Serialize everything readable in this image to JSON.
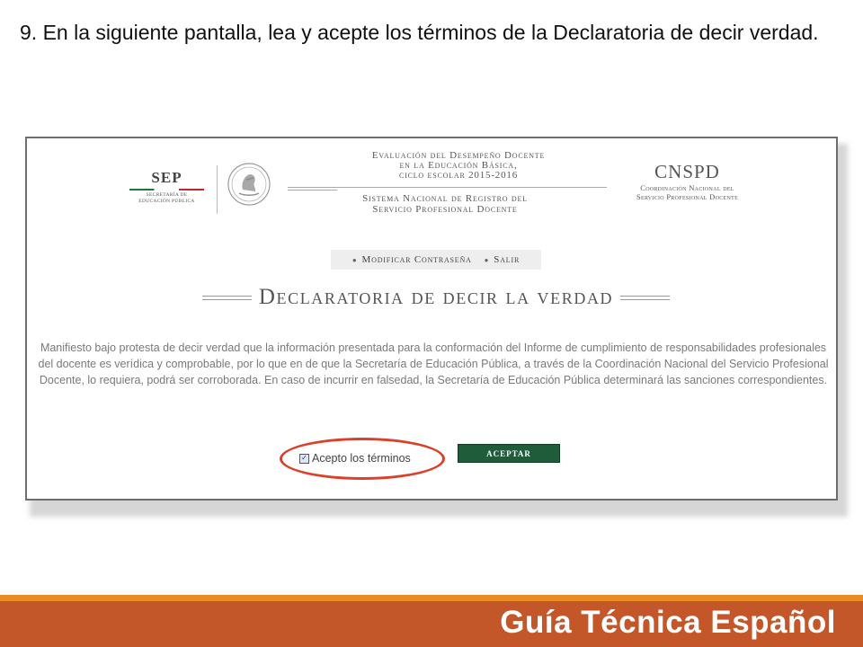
{
  "slide": {
    "heading": "9. En la siguiente pantalla, lea y acepte los términos de la Declaratoria de decir verdad."
  },
  "header": {
    "sep_logo_text": "SEP",
    "sep_subtitle_line1": "SECRETARÍA DE",
    "sep_subtitle_line2": "EDUCACIÓN PÚBLICA",
    "evaluation_line1": "Evaluación del Desempeño Docente",
    "evaluation_line2": "en la Educación Básica,",
    "evaluation_line3": "ciclo escolar 2015-2016",
    "sistema_line1": "Sistema Nacional de Registro del",
    "sistema_line2": "Servicio Profesional Docente",
    "cnspd_title": "CNSPD",
    "cnspd_line1": "Coordinación Nacional del",
    "cnspd_line2": "Servicio Profesional Docente"
  },
  "nav": {
    "change_password": "Modificar Contraseña",
    "logout": "Salir"
  },
  "main": {
    "title": "Declaratoria de decir la verdad",
    "declaration_text": "Manifiesto bajo protesta de decir verdad que la información presentada para la conformación del Informe de cumplimiento de responsabilidades profesionales del docente es verídica y comprobable, por lo que en de que la Secretaría de Educación Pública, a través de la Coordinación Nacional del Servicio Profesional Docente, lo requiera, podrá ser corroborada. En caso de incurrir en falsedad, la Secretaría de Educación Pública determinará las sanciones correspondientes.",
    "terms_checkbox_label": "Acepto los términos",
    "terms_checked": true,
    "accept_button": "ACEPTAR"
  },
  "footer": {
    "title": "Guía Técnica Español"
  },
  "colors": {
    "accept_button": "#1f5c3a",
    "highlight_ellipse": "#d9412b",
    "footer_bar": "#c4572a",
    "footer_stripe": "#ea8b25"
  }
}
